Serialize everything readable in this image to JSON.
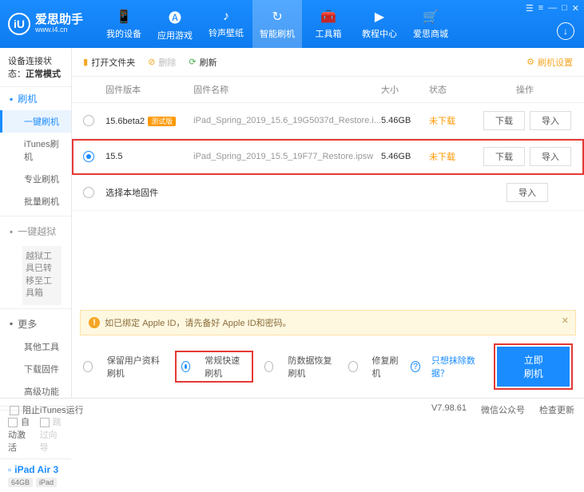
{
  "app": {
    "name": "爱思助手",
    "url": "www.i4.cn",
    "logo_letter": "iU"
  },
  "window_controls": [
    "☰",
    "≡",
    "—",
    "□",
    "✕"
  ],
  "nav": [
    {
      "icon": "📱",
      "label": "我的设备"
    },
    {
      "icon": "🅐",
      "label": "应用游戏"
    },
    {
      "icon": "♪",
      "label": "铃声壁纸"
    },
    {
      "icon": "↻",
      "label": "智能刷机",
      "active": true
    },
    {
      "icon": "🧰",
      "label": "工具箱"
    },
    {
      "icon": "▶",
      "label": "教程中心"
    },
    {
      "icon": "🛒",
      "label": "爱思商城"
    }
  ],
  "circ_btn": "↓",
  "sidebar": {
    "conn_label": "设备连接状态：",
    "conn_state": "正常模式",
    "groups": [
      {
        "header": "刷机",
        "color": "blue",
        "items": [
          {
            "label": "一键刷机",
            "active": true
          },
          {
            "label": "iTunes刷机"
          },
          {
            "label": "专业刷机"
          },
          {
            "label": "批量刷机"
          }
        ]
      },
      {
        "header": "一键越狱",
        "color": "gray",
        "box": "越狱工具已转移至工具箱"
      },
      {
        "header": "更多",
        "color": "dark",
        "items": [
          {
            "label": "其他工具"
          },
          {
            "label": "下载固件"
          },
          {
            "label": "高级功能"
          }
        ]
      }
    ],
    "auto_activate": "自动激活",
    "skip_guide": "跳过向导",
    "device": {
      "name": "iPad Air 3",
      "tags": [
        "64GB",
        "iPad"
      ],
      "icon": "▫"
    }
  },
  "toolbar": {
    "open": "打开文件夹",
    "delete": "删除",
    "refresh": "刷新",
    "settings": "刷机设置"
  },
  "thead": {
    "ver": "固件版本",
    "name": "固件名称",
    "size": "大小",
    "stat": "状态",
    "ops": "操作"
  },
  "rows": [
    {
      "selected": false,
      "version": "15.6beta2",
      "badge": "测试版",
      "file": "iPad_Spring_2019_15.6_19G5037d_Restore.i...",
      "size": "5.46GB",
      "status": "未下载",
      "ops": [
        "下载",
        "导入"
      ]
    },
    {
      "selected": true,
      "highlight": true,
      "version": "15.5",
      "file": "iPad_Spring_2019_15.5_19F77_Restore.ipsw",
      "size": "5.46GB",
      "status": "未下载",
      "ops": [
        "下载",
        "导入"
      ]
    },
    {
      "selected": false,
      "version": "选择本地固件",
      "local": true,
      "ops": [
        "导入"
      ]
    }
  ],
  "alert": {
    "icon": "!",
    "text": "如已绑定 Apple ID，请先备好 Apple ID和密码。"
  },
  "flash": {
    "opts": [
      {
        "label": "保留用户资料刷机"
      },
      {
        "label": "常规快速刷机",
        "selected": true,
        "highlight": true
      },
      {
        "label": "防数据恢复刷机"
      },
      {
        "label": "修复刷机"
      }
    ],
    "help": "?",
    "link": "只想抹除数据？",
    "action": "立即刷机"
  },
  "statusbar": {
    "block_itunes": "阻止iTunes运行",
    "version": "V7.98.61",
    "wechat": "微信公众号",
    "update": "检查更新"
  }
}
